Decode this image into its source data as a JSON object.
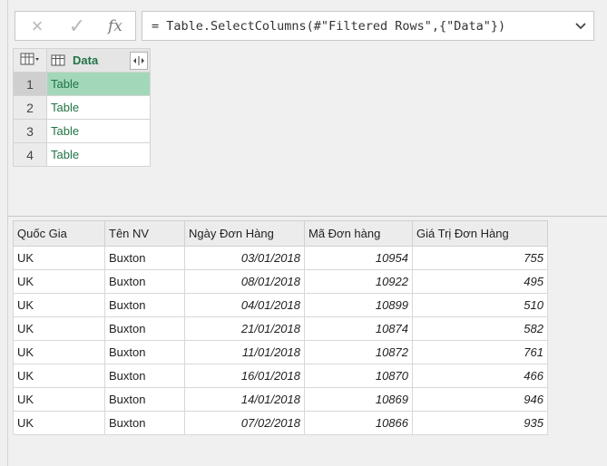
{
  "formula_bar": {
    "cancel_icon": "×",
    "commit_icon": "✓",
    "fx_label": "fx",
    "formula": "= Table.SelectColumns(#\"Filtered Rows\",{\"Data\"})"
  },
  "preview": {
    "column_header": "Data",
    "rows": [
      {
        "num": "1",
        "value": "Table"
      },
      {
        "num": "2",
        "value": "Table"
      },
      {
        "num": "3",
        "value": "Table"
      },
      {
        "num": "4",
        "value": "Table"
      }
    ]
  },
  "detail": {
    "headers": [
      "Quốc Gia",
      "Tên NV",
      "Ngày Đơn Hàng",
      "Mã Đơn hàng",
      "Giá Trị Đơn Hàng"
    ],
    "rows": [
      [
        "UK",
        "Buxton",
        "03/01/2018",
        "10954",
        "755"
      ],
      [
        "UK",
        "Buxton",
        "08/01/2018",
        "10922",
        "495"
      ],
      [
        "UK",
        "Buxton",
        "04/01/2018",
        "10899",
        "510"
      ],
      [
        "UK",
        "Buxton",
        "21/01/2018",
        "10874",
        "582"
      ],
      [
        "UK",
        "Buxton",
        "11/01/2018",
        "10872",
        "761"
      ],
      [
        "UK",
        "Buxton",
        "16/01/2018",
        "10870",
        "466"
      ],
      [
        "UK",
        "Buxton",
        "14/01/2018",
        "10869",
        "946"
      ],
      [
        "UK",
        "Buxton",
        "07/02/2018",
        "10866",
        "935"
      ]
    ]
  },
  "colors": {
    "accent": "#217346",
    "selected_row": "#a2d8b9"
  }
}
